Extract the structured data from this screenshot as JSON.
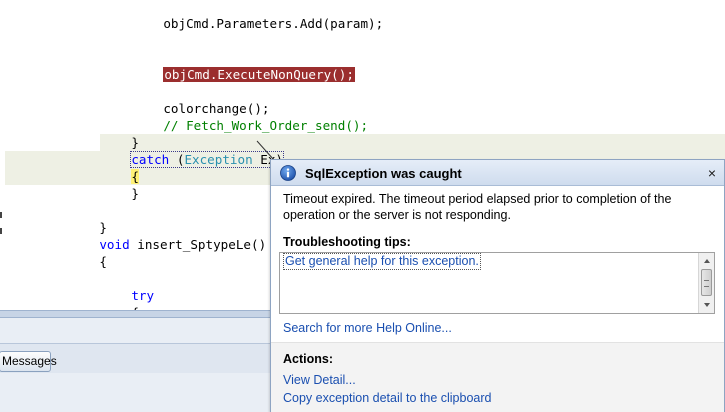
{
  "editor": {
    "lines": {
      "params_add": "objCmd.Parameters.Add(param);",
      "execute": "objCmd.ExecuteNonQuery();",
      "colorchange": "colorchange();",
      "comment_fetch": "// Fetch_Work_Order_send();",
      "close_try": "}",
      "catch_kw": "catch",
      "catch_open_paren": " (",
      "catch_type": "Exception",
      "catch_var": " Ex)",
      "open_brace": "{",
      "close_brace": "}",
      "method_close": "}",
      "method_void": "void",
      "method_name": " insert_SptypeLe()",
      "method_open": "{",
      "try_kw": "try",
      "try_open": "{"
    }
  },
  "panel": {
    "messages_tab": "Messages"
  },
  "exception": {
    "title": "SqlException was caught",
    "close_glyph": "×",
    "message": "Timeout expired.  The timeout period elapsed prior to completion of the operation or the server is not responding.",
    "tips_heading": "Troubleshooting tips:",
    "tips": [
      "Get general help for this exception."
    ],
    "search_link": "Search for more Help Online...",
    "actions_heading": "Actions:",
    "actions": [
      "View Detail...",
      "Copy exception detail to the clipboard"
    ],
    "icon": "info-icon"
  },
  "colors": {
    "error_highlight": "#9b2e2e",
    "keyword": "#0000ff",
    "type": "#2b91af",
    "comment": "#008000",
    "link": "#1a4fb0"
  }
}
